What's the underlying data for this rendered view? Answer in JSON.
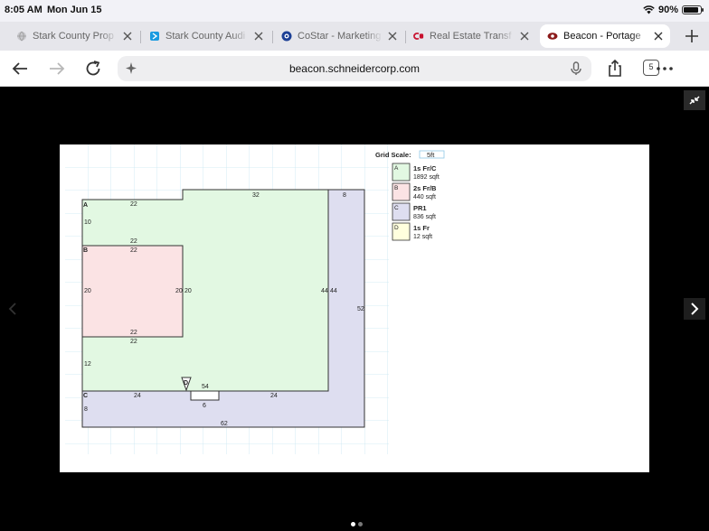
{
  "status": {
    "time": "8:05 AM",
    "date": "Mon Jun 15",
    "battery": "90%",
    "battery_level": 0.9
  },
  "tabs": [
    {
      "title": "Stark County Prop",
      "icon": "globe-icon",
      "active": false
    },
    {
      "title": "Stark County Audi",
      "icon": "beacon-logo-icon",
      "active": false
    },
    {
      "title": "CoStar - Marketing",
      "icon": "costar-logo-icon",
      "active": false
    },
    {
      "title": "Real Estate Transf",
      "icon": "cp-logo-icon",
      "active": false
    },
    {
      "title": "Beacon - Portage",
      "icon": "beacon-eye-icon",
      "active": true
    }
  ],
  "url": "beacon.schneidercorp.com",
  "tab_count": "5",
  "sketch": {
    "grid_scale_label": "Grid Scale:",
    "grid_scale_value": "5ft",
    "legend": [
      {
        "key": "A",
        "name": "1s Fr/C",
        "area": "1892 sqft",
        "color": "#e2f8e2"
      },
      {
        "key": "B",
        "name": "2s Fr/B",
        "area": "440 sqft",
        "color": "#fbe3e4"
      },
      {
        "key": "C",
        "name": "PR1",
        "area": "836 sqft",
        "color": "#dedef0"
      },
      {
        "key": "D",
        "name": "1s Fr",
        "area": "12 sqft",
        "color": "#ffffde"
      }
    ],
    "area_labels": {
      "a": "A",
      "b": "B",
      "c": "C",
      "d": "D"
    },
    "dimensions": {
      "a_top_left": "22",
      "a_top_right": "32",
      "a_left": "10",
      "b_top_outer": "22",
      "b_top_inner": "22",
      "b_left": "20",
      "b_right": "20",
      "a_inner_20": "20",
      "b_bottom_inner": "22",
      "b_bottom_outer": "22",
      "a_lower_left": "12",
      "a_right": "44",
      "c_inner_right": "44",
      "c_top_right": "8",
      "c_right": "52",
      "c_bottom": "62",
      "c_left": "8",
      "c_top_left": "24",
      "c_top_mid": "24",
      "d_label_54": "54",
      "d_width": "6"
    }
  }
}
